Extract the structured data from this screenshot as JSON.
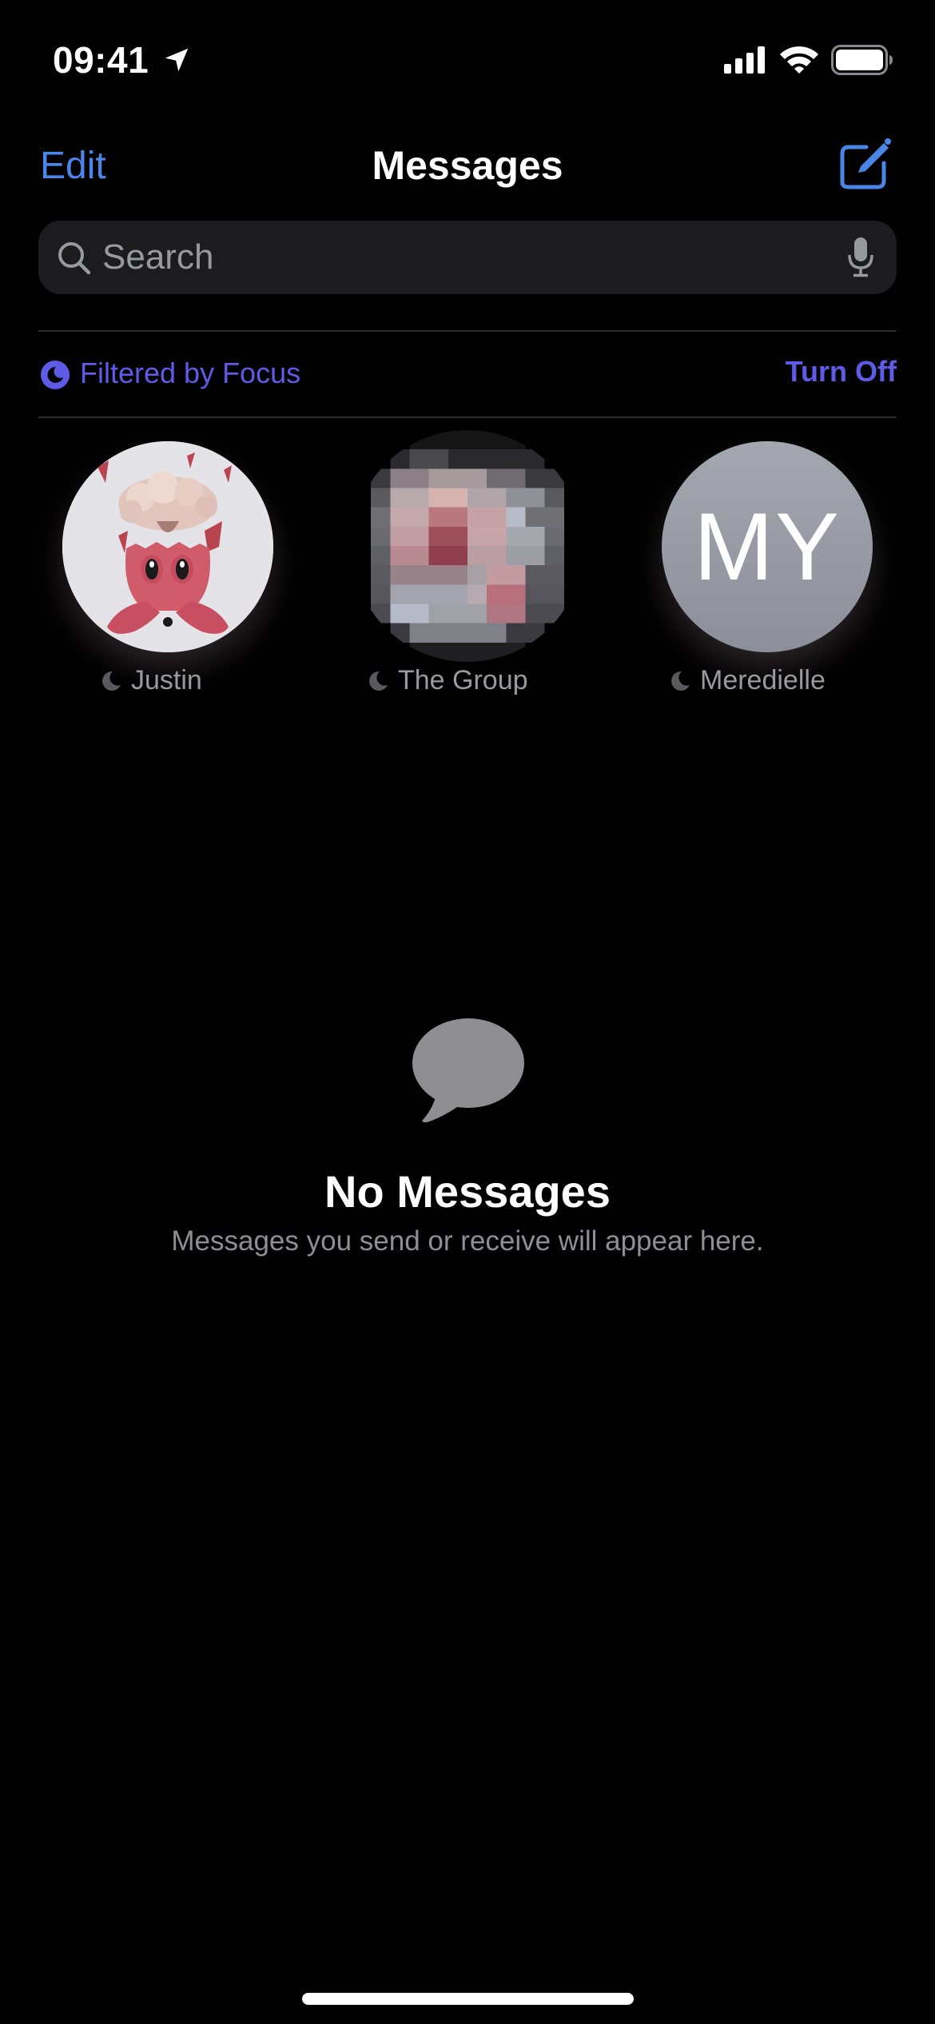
{
  "status_bar": {
    "time": "09:41",
    "icons": [
      "location-arrow-icon",
      "cellular-signal-icon",
      "wifi-icon",
      "battery-icon"
    ],
    "battery_level": 1.0
  },
  "nav": {
    "edit_label": "Edit",
    "title": "Messages",
    "compose_icon": "compose-icon"
  },
  "search": {
    "placeholder": "Search",
    "value": "",
    "icon": "search-icon",
    "mic_icon": "microphone-icon"
  },
  "focus": {
    "label": "Filtered by Focus",
    "turn_off_label": "Turn Off",
    "icon": "focus-moon-icon"
  },
  "pinned": [
    {
      "name": "Justin",
      "avatar": "memoji-octopus",
      "status_icon": "moon-icon"
    },
    {
      "name": "The Group",
      "avatar": "pixelated-group-photo",
      "status_icon": "moon-icon"
    },
    {
      "name": "Meredielle",
      "initials": "MY",
      "status_icon": "moon-icon"
    }
  ],
  "empty_state": {
    "icon": "message-bubble-icon",
    "title": "No Messages",
    "subtitle": "Messages you send or receive will appear here."
  },
  "colors": {
    "accent_blue": "#4A86E8",
    "focus_indigo": "#5E5CE6",
    "secondary_gray": "#8E8E93",
    "search_bg": "#1C1C1E"
  }
}
